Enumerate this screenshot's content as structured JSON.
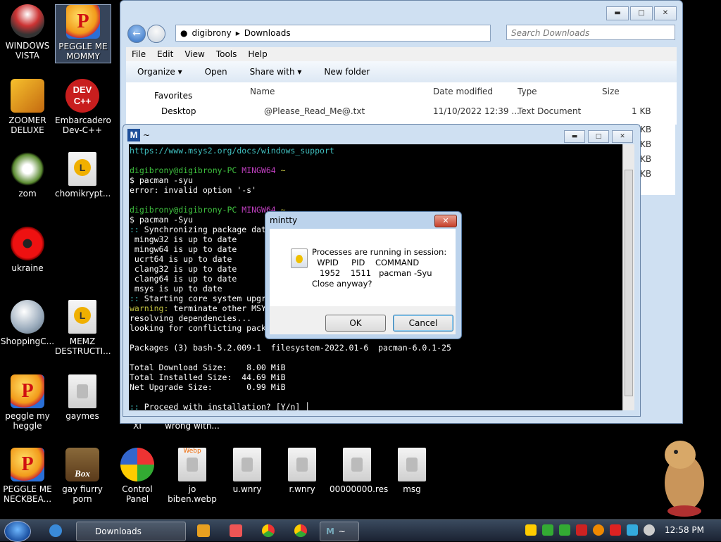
{
  "desktop": {
    "icons": [
      {
        "label": "WINDOWS VISTA"
      },
      {
        "label": "PEGGLE ME MOMMY"
      },
      {
        "label": "ZOOMER DELUXE"
      },
      {
        "label": "Embarcadero Dev-C++"
      },
      {
        "label": "zom"
      },
      {
        "label": "chomikrypt..."
      },
      {
        "label": "ukraine"
      },
      {
        "label": "ShoppingC..."
      },
      {
        "label": "MEMZ DESTRUCTI..."
      },
      {
        "label": "peggle my heggle"
      },
      {
        "label": "gaymes"
      },
      {
        "label": "XI"
      },
      {
        "label": "wrong with..."
      },
      {
        "label": "PEGGLE ME NECKBEA..."
      },
      {
        "label": "gay fiurry porn"
      },
      {
        "label": "Control Panel"
      },
      {
        "label": "jo biben.webp"
      },
      {
        "label": "u.wnry"
      },
      {
        "label": "r.wnry"
      },
      {
        "label": "00000000.res"
      },
      {
        "label": "msg"
      }
    ],
    "dev_icon_text": "DEV C++",
    "box_icon_text": "Box",
    "webp_icon_text": "Webp"
  },
  "explorer": {
    "breadcrumb": [
      "digibrony",
      "Downloads"
    ],
    "search_placeholder": "Search Downloads",
    "menu": [
      "File",
      "Edit",
      "View",
      "Tools",
      "Help"
    ],
    "commands": [
      "Organize ▾",
      "Open",
      "Share with ▾",
      "New folder"
    ],
    "nav": [
      "Favorites",
      "Desktop"
    ],
    "columns": [
      "Name",
      "Date modified",
      "Type",
      "Size"
    ],
    "file": {
      "name": "@Please_Read_Me@.txt",
      "date": "11/10/2022 12:39 ...",
      "type": "Text Document",
      "size": "1 KB"
    },
    "hidden_sizes": [
      "KB",
      "KB",
      "KB",
      "KB"
    ]
  },
  "mintty": {
    "title": "~",
    "logo": "M"
  },
  "dialog": {
    "title": "mintty",
    "message": "Processes are running in session:\n  WPID     PID    COMMAND\n   1952    1511   pacman -Syu\nClose anyway?",
    "ok": "OK",
    "cancel": "Cancel"
  },
  "taskbar": {
    "downloads": "Downloads",
    "mintty": "~",
    "time": "12:58 PM"
  },
  "colors": {
    "terminal_green": "#3fc23f",
    "terminal_magenta": "#c040c0",
    "terminal_cyan": "#40c0c0"
  }
}
